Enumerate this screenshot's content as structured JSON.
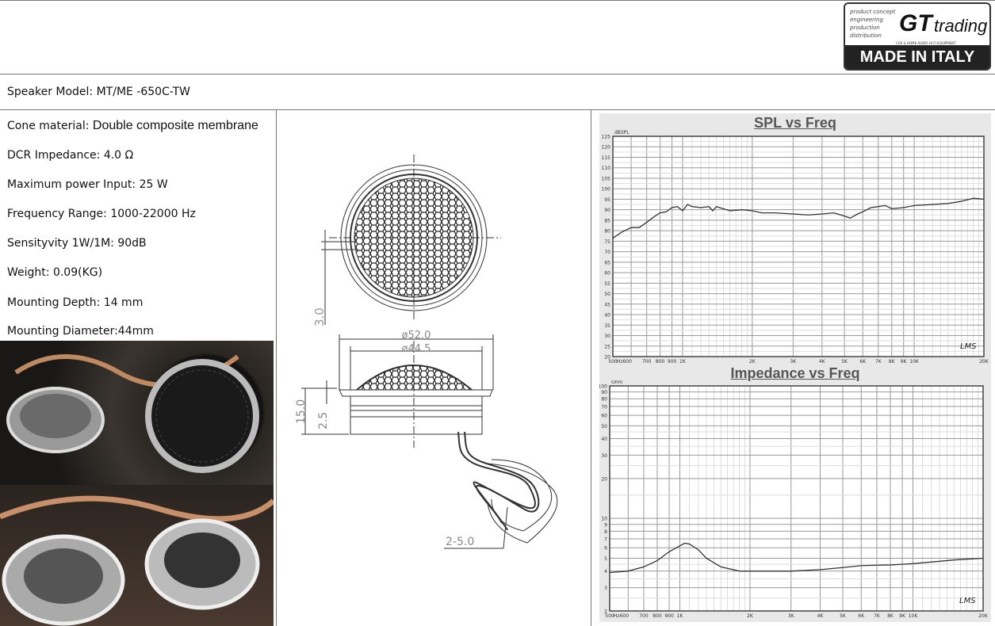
{
  "logo": {
    "lines": [
      "product concept",
      "engineering",
      "production",
      "distribution"
    ],
    "brand_gt": "GT",
    "brand_trading": "trading",
    "subtitle": "CAR & HOME AUDIO HI-FI EQUIPMENT",
    "made_in": "MADE IN ITALY"
  },
  "model": "Speaker Model: MT/ME -650C-TW",
  "specs": {
    "cone_label": "Cone material: ",
    "cone_value": "Double  composite membrane",
    "dcr": "DCR Impedance: 4.0 Ω",
    "power": "Maximum power Input: 25 W",
    "freq": "Frequency Range: 1000-22000 Hz",
    "sens": "Sensityvity 1W/1M: 90dB",
    "weight": "Weight: 0.09(KG)",
    "depth": "Mounting Depth: 14 mm",
    "diameter": "Mounting Diameter:44mm"
  },
  "drawing": {
    "d_outer": "ø52.0",
    "d_inner": "ø44.5",
    "height": "15.0",
    "flange": "2.5",
    "top": "3.0",
    "wire": "2-5.0"
  },
  "chart_data": [
    {
      "type": "line",
      "title": "SPL vs Freq",
      "ylabel": "dBSPL",
      "xscale": "log",
      "xlim": [
        500,
        20000
      ],
      "ylim": [
        20,
        125
      ],
      "yticks": [
        20,
        25,
        30,
        35,
        40,
        45,
        50,
        55,
        60,
        65,
        70,
        75,
        80,
        85,
        90,
        95,
        100,
        105,
        110,
        115,
        120,
        125
      ],
      "xticks": [
        {
          "v": 500,
          "l": "500"
        },
        {
          "v": 560,
          "l": "Hz600"
        },
        {
          "v": 700,
          "l": "700"
        },
        {
          "v": 800,
          "l": "800"
        },
        {
          "v": 900,
          "l": "900"
        },
        {
          "v": 1000,
          "l": "1K"
        },
        {
          "v": 2000,
          "l": "2K"
        },
        {
          "v": 3000,
          "l": "3K"
        },
        {
          "v": 4000,
          "l": "4K"
        },
        {
          "v": 5000,
          "l": "5K"
        },
        {
          "v": 6000,
          "l": "6K"
        },
        {
          "v": 7000,
          "l": "7K"
        },
        {
          "v": 8000,
          "l": "8K"
        },
        {
          "v": 9000,
          "l": "9K"
        },
        {
          "v": 10000,
          "l": "10K"
        },
        {
          "v": 20000,
          "l": "20K"
        }
      ],
      "watermark": "LMS",
      "x": [
        500,
        550,
        600,
        650,
        700,
        750,
        800,
        850,
        900,
        950,
        1000,
        1050,
        1100,
        1200,
        1300,
        1350,
        1400,
        1600,
        1800,
        2000,
        2200,
        2500,
        3000,
        3500,
        4000,
        4500,
        5000,
        5300,
        5700,
        6000,
        6500,
        7000,
        7500,
        8000,
        9000,
        10000,
        12000,
        14000,
        16000,
        18000,
        20000
      ],
      "y": [
        76.5,
        79.5,
        81.5,
        81.5,
        84,
        86.5,
        88.5,
        89,
        91,
        91.5,
        89.5,
        92.5,
        91.5,
        91,
        91.5,
        89.5,
        91.5,
        89.5,
        90,
        89.5,
        88.5,
        88.5,
        88,
        87.5,
        88,
        88.5,
        87,
        86,
        88,
        89,
        91,
        91.5,
        92,
        90.5,
        91,
        92,
        92.5,
        93,
        94,
        95.5,
        95
      ]
    },
    {
      "type": "line",
      "title": "Impedance vs Freq",
      "ylabel": "Ohm",
      "xscale": "log",
      "yscale": "log",
      "xlim": [
        500,
        20000
      ],
      "ylim": [
        2,
        100
      ],
      "yticks": [
        2,
        3,
        4,
        5,
        6,
        7,
        8,
        9,
        10,
        20,
        30,
        40,
        50,
        60,
        70,
        80,
        90,
        100
      ],
      "xticks": [
        {
          "v": 500,
          "l": "500"
        },
        {
          "v": 560,
          "l": "Hz600"
        },
        {
          "v": 700,
          "l": "700"
        },
        {
          "v": 800,
          "l": "800"
        },
        {
          "v": 900,
          "l": "900"
        },
        {
          "v": 1000,
          "l": "1K"
        },
        {
          "v": 2000,
          "l": "2K"
        },
        {
          "v": 3000,
          "l": "3K"
        },
        {
          "v": 4000,
          "l": "4K"
        },
        {
          "v": 5000,
          "l": "5K"
        },
        {
          "v": 6000,
          "l": "6K"
        },
        {
          "v": 7000,
          "l": "7K"
        },
        {
          "v": 8000,
          "l": "8K"
        },
        {
          "v": 9000,
          "l": "9K"
        },
        {
          "v": 10000,
          "l": "10K"
        },
        {
          "v": 20000,
          "l": "20K"
        }
      ],
      "watermark": "LMS",
      "x": [
        500,
        600,
        700,
        800,
        900,
        1000,
        1050,
        1100,
        1200,
        1300,
        1500,
        1800,
        2000,
        3000,
        4000,
        5000,
        6000,
        8000,
        10000,
        15000,
        20000
      ],
      "y": [
        3.9,
        4.0,
        4.3,
        4.8,
        5.6,
        6.2,
        6.5,
        6.4,
        5.8,
        5.0,
        4.3,
        4.0,
        4.0,
        4.0,
        4.1,
        4.25,
        4.4,
        4.45,
        4.55,
        4.85,
        5.0
      ]
    }
  ]
}
